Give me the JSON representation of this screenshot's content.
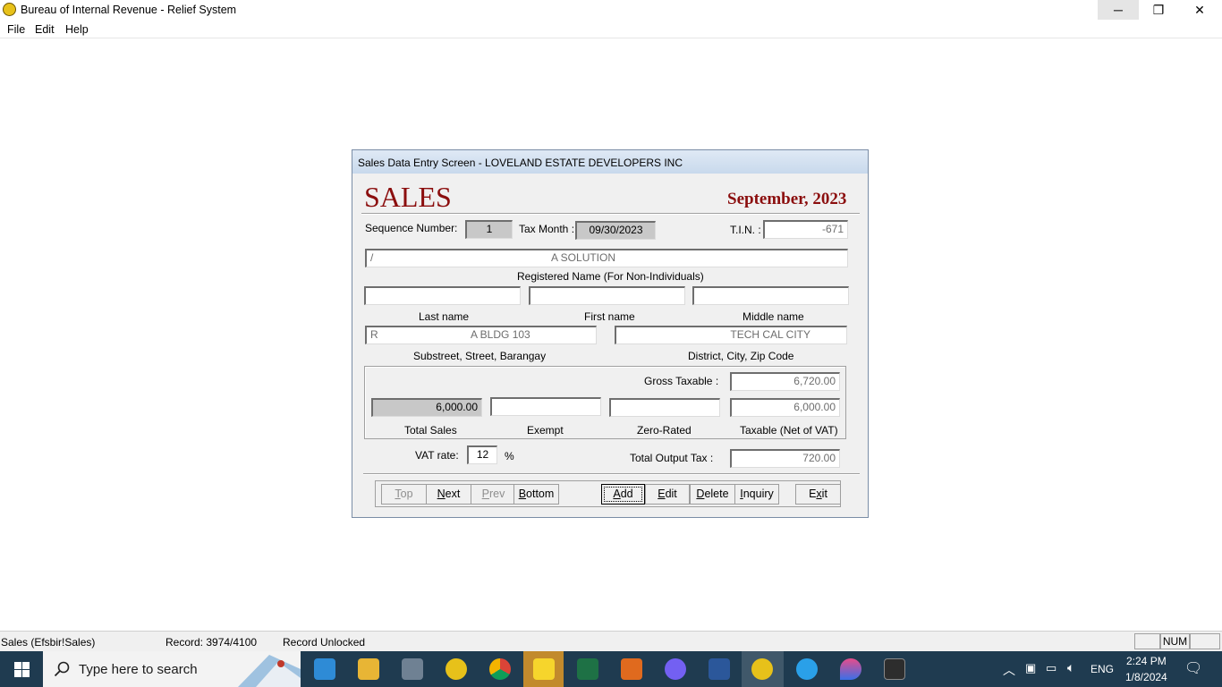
{
  "window": {
    "title": "Bureau of Internal Revenue - Relief System",
    "min_glyph": "─",
    "max_glyph": "❐",
    "close_glyph": "✕"
  },
  "menu": [
    "File",
    "Edit",
    "Help"
  ],
  "dialog": {
    "caption": "Sales Data Entry Screen - LOVELAND ESTATE DEVELOPERS INC",
    "heading": "SALES",
    "month": "September, 2023",
    "sequence_label": "Sequence Number:",
    "sequence_value": "1",
    "tax_month_label": "Tax Month :",
    "tax_month_value": "09/30/2023",
    "tin_label": "T.I.N. :",
    "tin_value": "-671",
    "registered_name_value_left": "/",
    "registered_name_value": "A SOLUTION",
    "registered_name_label": "Registered Name  (For Non-Individuals)",
    "last_name_label": "Last name",
    "first_name_label": "First name",
    "middle_name_label": "Middle name",
    "street_value_left": "R",
    "street_value": "A BLDG 103",
    "street_label": "Substreet, Street, Barangay",
    "city_value": "TECH CAL CITY",
    "city_label": "District, City, Zip Code",
    "gross_taxable_label": "Gross Taxable :",
    "gross_taxable_value": "6,720.00",
    "total_sales_value": "6,000.00",
    "taxable_value": "6,000.00",
    "total_sales_label": "Total Sales",
    "exempt_label": "Exempt",
    "zero_rated_label": "Zero-Rated",
    "taxable_label": "Taxable (Net of VAT)",
    "vat_rate_label": "VAT rate:",
    "vat_rate_value": "12",
    "percent": "%",
    "output_tax_label": "Total Output Tax :",
    "output_tax_value": "720.00"
  },
  "buttons": {
    "top": {
      "u": "T",
      "rest": "op"
    },
    "next": {
      "u": "N",
      "rest": "ext"
    },
    "prev": {
      "u": "P",
      "rest": "rev"
    },
    "bottom": {
      "u": "B",
      "rest": "ottom"
    },
    "add": {
      "u": "A",
      "rest": "dd"
    },
    "edit": {
      "u": "E",
      "rest": "dit"
    },
    "delete": {
      "u": "D",
      "rest": "elete"
    },
    "inquiry": {
      "u": "I",
      "rest": "nquiry"
    },
    "exit": {
      "pre": "E",
      "u": "x",
      "rest": "it"
    }
  },
  "status": {
    "table": "Sales (Efsbir!Sales)",
    "record": "Record: 3974/4100",
    "lock": "Record Unlocked",
    "num": "NUM"
  },
  "taskbar": {
    "search_placeholder": "Type here to search",
    "language": "ENG",
    "time": "2:24 PM",
    "date": "1/8/2024"
  },
  "colors": {
    "heading_red": "#8b0e0e",
    "taskbar": "#1f3b50"
  }
}
